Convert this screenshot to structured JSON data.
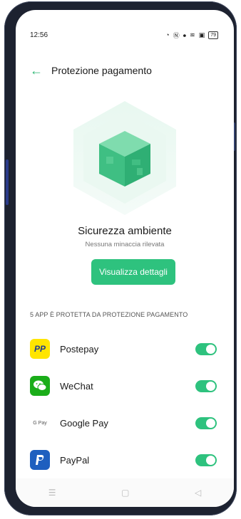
{
  "status_bar": {
    "time": "12:56",
    "battery": "79"
  },
  "header": {
    "title": "Protezione pagamento"
  },
  "status": {
    "title": "Sicurezza ambiente",
    "subtitle": "Nessuna minaccia rilevata",
    "button_label": "Visualizza dettagli"
  },
  "section": {
    "header": "5 APP È PROTETTA DA PROTEZIONE PAGAMENTO"
  },
  "apps": [
    {
      "name": "Postepay",
      "icon": "postepay-icon",
      "enabled": true
    },
    {
      "name": "WeChat",
      "icon": "wechat-icon",
      "enabled": true
    },
    {
      "name": "Google Pay",
      "icon": "google-pay-icon",
      "enabled": true
    },
    {
      "name": "PayPal",
      "icon": "paypal-icon",
      "enabled": true
    }
  ],
  "colors": {
    "accent": "#2ec27e",
    "back_arrow": "#2bb673"
  },
  "icon_text": {
    "postepay": "PP",
    "gpay": "G Pay"
  }
}
